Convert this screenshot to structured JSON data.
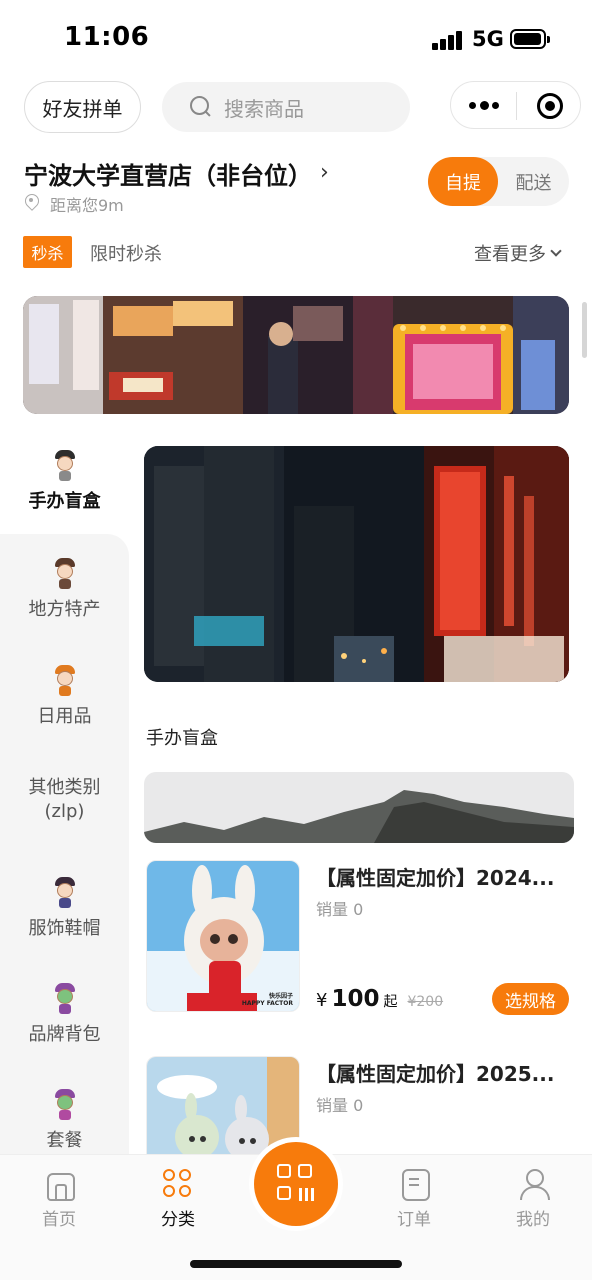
{
  "status_bar": {
    "time": "11:06",
    "network": "5G"
  },
  "header": {
    "group_buy_button": "好友拼单",
    "search_placeholder": "搜索商品"
  },
  "store": {
    "name": "宁波大学直营店（非台位）",
    "chevron": "›",
    "distance": "距离您9m",
    "mode_active": "自提",
    "mode_inactive": "配送"
  },
  "flash_sale": {
    "tag": "秒杀",
    "label": "限时秒杀",
    "see_more": "查看更多"
  },
  "categories": [
    {
      "label": "手办盲盒",
      "active": true
    },
    {
      "label": "地方特产",
      "active": false
    },
    {
      "label": "日用品",
      "active": false
    },
    {
      "label": "其他类别\n(zlp)",
      "active": false
    },
    {
      "label": "服饰鞋帽",
      "active": false
    },
    {
      "label": "品牌背包",
      "active": false
    },
    {
      "label": "套餐",
      "active": false
    }
  ],
  "section": {
    "title": "手办盲盒"
  },
  "products": [
    {
      "title": "【属性固定加价】2024...",
      "sales": "销量 0",
      "price_symbol": "¥",
      "price": "100",
      "price_suffix": "起",
      "original_price": "¥200",
      "spec_button": "选规格",
      "image_caption": "快乐因子\nHAPPY FACTOR"
    },
    {
      "title": "【属性固定加价】2025...",
      "sales": "销量 0"
    }
  ],
  "tabbar": {
    "home": "首页",
    "category": "分类",
    "orders": "订单",
    "me": "我的"
  },
  "colors": {
    "accent": "#f77b0c"
  }
}
